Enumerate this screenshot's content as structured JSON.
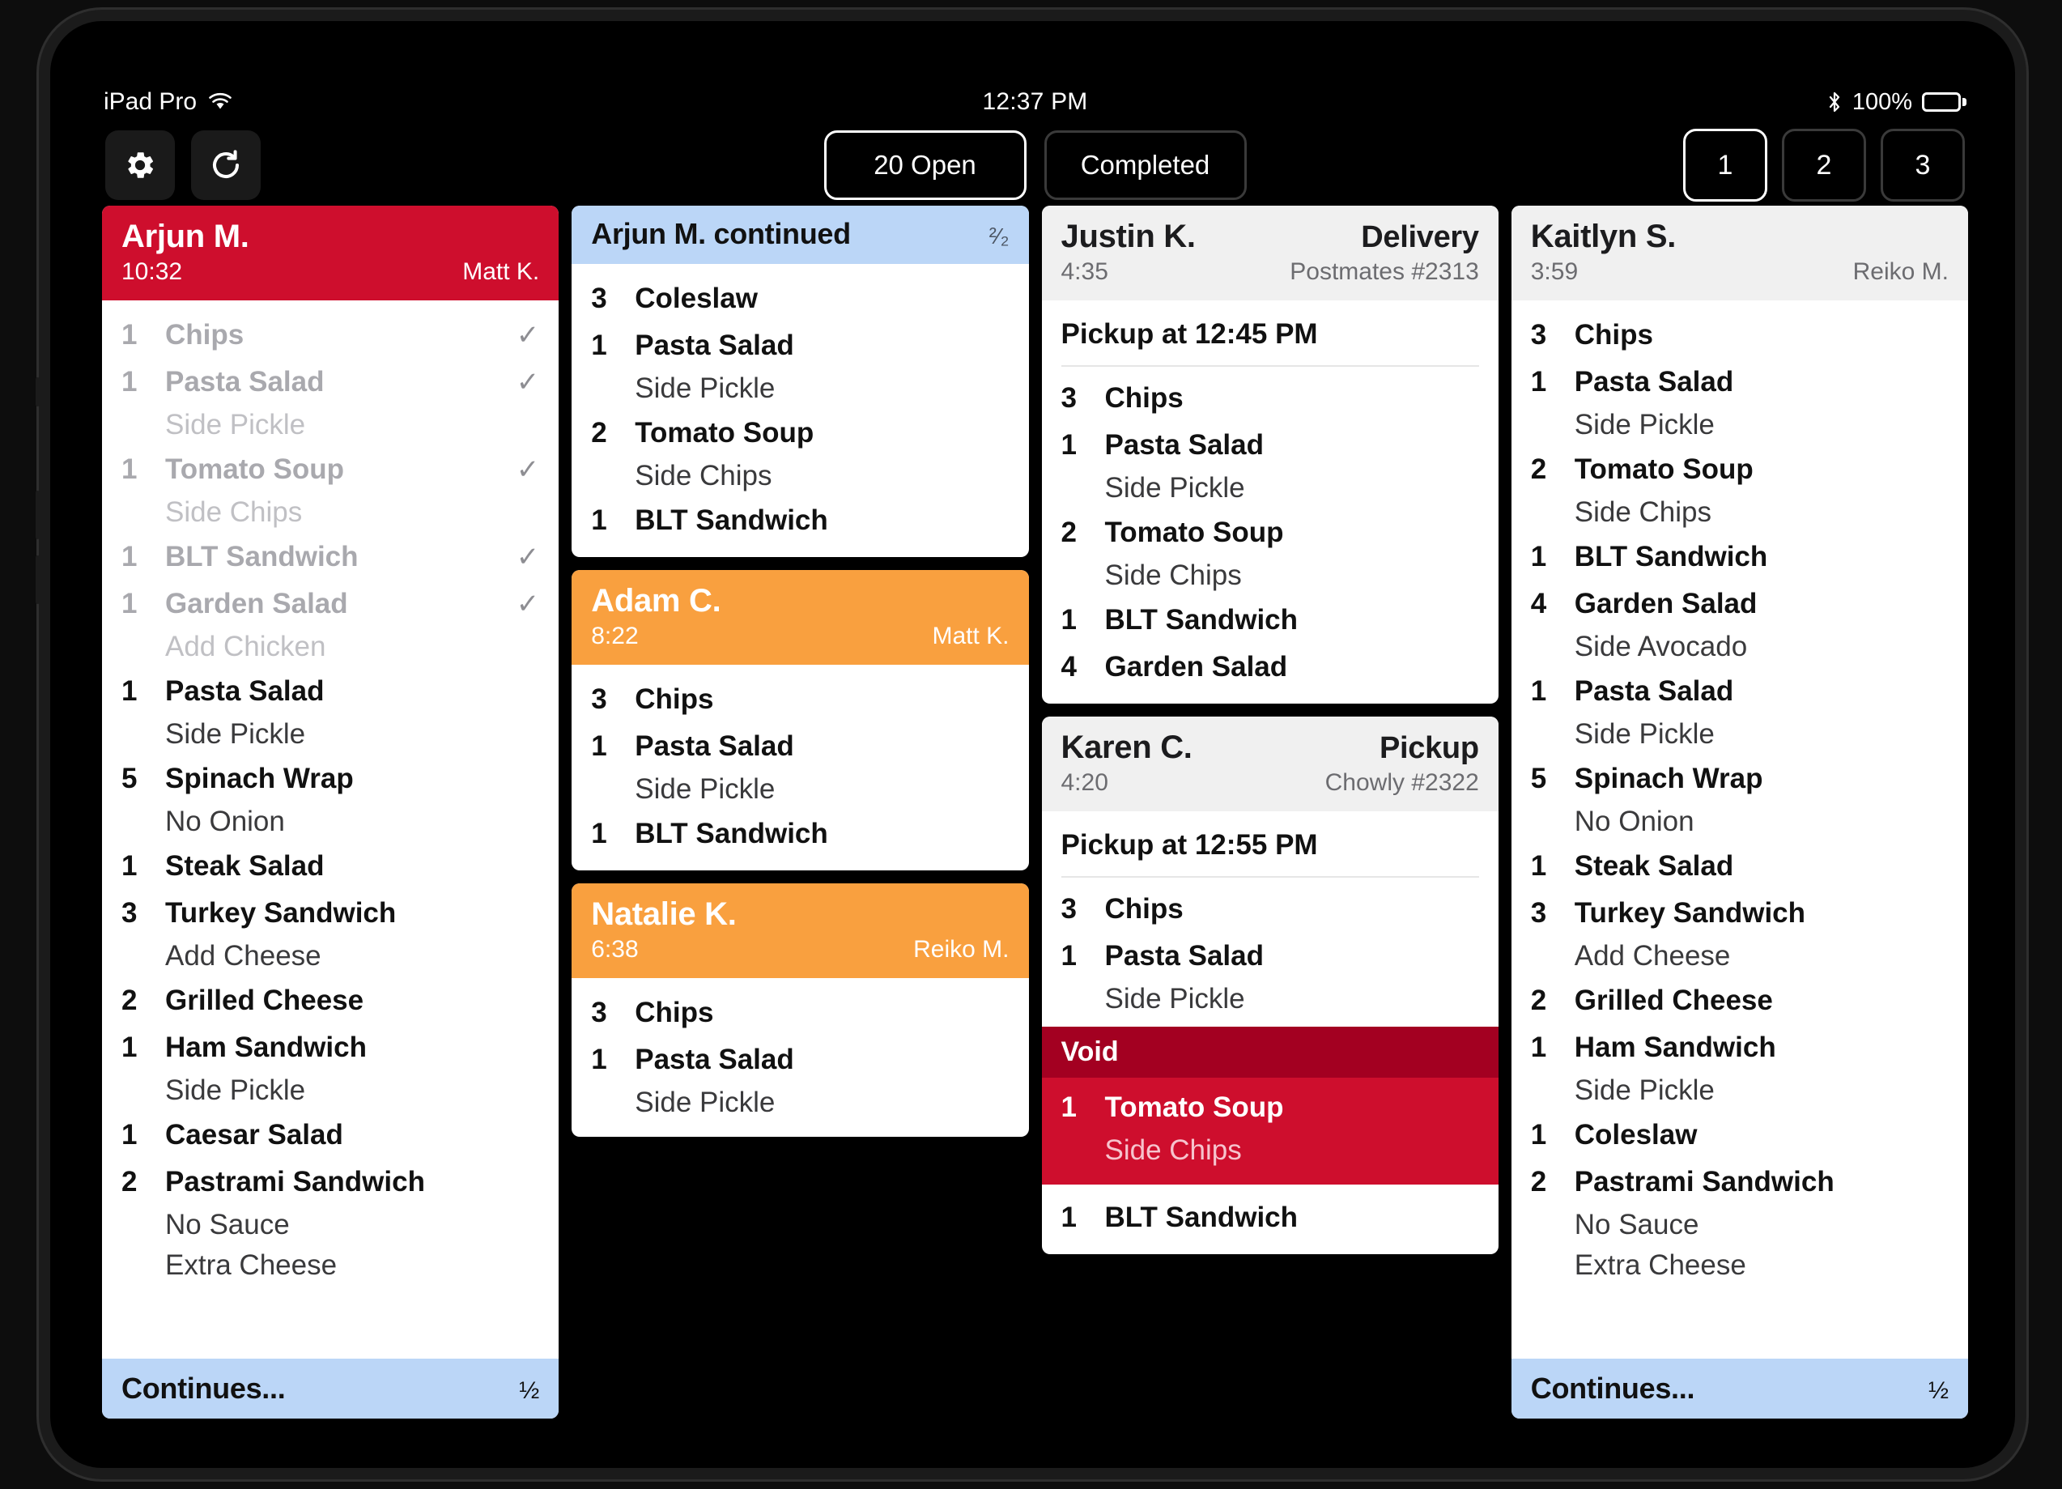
{
  "status_bar": {
    "device": "iPad Pro",
    "wifi_icon": "wifi-icon",
    "time": "12:37 PM",
    "bluetooth_icon": "bluetooth-icon",
    "battery_percent": "100%",
    "battery_icon": "battery-full-icon"
  },
  "toolbar": {
    "settings_icon": "gear-icon",
    "refresh_icon": "refresh-icon",
    "tabs": [
      {
        "label": "20 Open",
        "active": true
      },
      {
        "label": "Completed",
        "active": false
      }
    ],
    "pages": [
      {
        "label": "1",
        "active": true
      },
      {
        "label": "2",
        "active": false
      },
      {
        "label": "3",
        "active": false
      }
    ]
  },
  "colors": {
    "red": "#CE0E2D",
    "red_dark": "#A30021",
    "orange": "#F9A03F",
    "gray_header": "#F0F0F0",
    "blue_footer": "#BBD6F7"
  },
  "columns": [
    {
      "tickets": [
        {
          "name": "Arjun M.",
          "time": "10:32",
          "server": "Matt K.",
          "header_style": "red",
          "items": [
            {
              "qty": "1",
              "name": "Chips",
              "done": true,
              "check": "✓"
            },
            {
              "qty": "1",
              "name": "Pasta Salad",
              "done": true,
              "check": "✓"
            },
            {
              "mod": "Side Pickle",
              "done": true
            },
            {
              "qty": "1",
              "name": "Tomato Soup",
              "done": true,
              "check": "✓"
            },
            {
              "mod": "Side Chips",
              "done": true
            },
            {
              "qty": "1",
              "name": "BLT Sandwich",
              "done": true,
              "check": "✓"
            },
            {
              "qty": "1",
              "name": "Garden Salad",
              "done": true,
              "check": "✓"
            },
            {
              "mod": "Add Chicken",
              "done": true
            },
            {
              "qty": "1",
              "name": "Pasta Salad"
            },
            {
              "mod": "Side Pickle"
            },
            {
              "qty": "5",
              "name": "Spinach Wrap"
            },
            {
              "mod": "No Onion"
            },
            {
              "qty": "1",
              "name": "Steak Salad"
            },
            {
              "qty": "3",
              "name": "Turkey Sandwich"
            },
            {
              "mod": "Add Cheese"
            },
            {
              "qty": "2",
              "name": "Grilled Cheese"
            },
            {
              "qty": "1",
              "name": "Ham Sandwich"
            },
            {
              "mod": "Side Pickle"
            },
            {
              "qty": "1",
              "name": "Caesar Salad"
            },
            {
              "qty": "2",
              "name": "Pastrami Sandwich"
            },
            {
              "mod": "No Sauce"
            },
            {
              "mod": "Extra Cheese"
            }
          ],
          "footer": {
            "label": "Continues...",
            "fraction": "½"
          }
        }
      ]
    },
    {
      "tickets": [
        {
          "continuation_title": "Arjun M. continued",
          "fraction": "²⁄₂",
          "items": [
            {
              "qty": "3",
              "name": "Coleslaw"
            },
            {
              "qty": "1",
              "name": "Pasta Salad"
            },
            {
              "mod": "Side Pickle"
            },
            {
              "qty": "2",
              "name": "Tomato Soup"
            },
            {
              "mod": "Side Chips"
            },
            {
              "qty": "1",
              "name": "BLT Sandwich"
            }
          ]
        },
        {
          "name": "Adam C.",
          "time": "8:22",
          "server": "Matt K.",
          "header_style": "orange",
          "items": [
            {
              "qty": "3",
              "name": "Chips"
            },
            {
              "qty": "1",
              "name": "Pasta Salad"
            },
            {
              "mod": "Side Pickle"
            },
            {
              "qty": "1",
              "name": "BLT Sandwich"
            }
          ]
        },
        {
          "name": "Natalie K.",
          "time": "6:38",
          "server": "Reiko M.",
          "header_style": "orange",
          "items": [
            {
              "qty": "3",
              "name": "Chips"
            },
            {
              "qty": "1",
              "name": "Pasta Salad"
            },
            {
              "mod": "Side Pickle"
            }
          ]
        }
      ]
    },
    {
      "tickets": [
        {
          "name": "Justin K.",
          "time": "4:35",
          "order_type": "Delivery",
          "source": "Postmates #2313",
          "header_style": "gray",
          "pickup_line": "Pickup at 12:45 PM",
          "items": [
            {
              "qty": "3",
              "name": "Chips"
            },
            {
              "qty": "1",
              "name": "Pasta Salad"
            },
            {
              "mod": "Side Pickle"
            },
            {
              "qty": "2",
              "name": "Tomato Soup"
            },
            {
              "mod": "Side Chips"
            },
            {
              "qty": "1",
              "name": "BLT Sandwich"
            },
            {
              "qty": "4",
              "name": "Garden Salad"
            }
          ]
        },
        {
          "name": "Karen C.",
          "time": "4:20",
          "order_type": "Pickup",
          "source": "Chowly #2322",
          "header_style": "gray",
          "pickup_line": "Pickup at 12:55 PM",
          "items": [
            {
              "qty": "3",
              "name": "Chips"
            },
            {
              "qty": "1",
              "name": "Pasta Salad"
            },
            {
              "mod": "Side Pickle"
            }
          ],
          "void": {
            "label": "Void",
            "items": [
              {
                "qty": "1",
                "name": "Tomato Soup"
              },
              {
                "mod": "Side Chips"
              }
            ]
          },
          "items_after_void": [
            {
              "qty": "1",
              "name": "BLT Sandwich"
            }
          ]
        }
      ]
    },
    {
      "tickets": [
        {
          "name": "Kaitlyn S.",
          "time": "3:59",
          "server": "Reiko M.",
          "header_style": "gray",
          "items": [
            {
              "qty": "3",
              "name": "Chips"
            },
            {
              "qty": "1",
              "name": "Pasta Salad"
            },
            {
              "mod": "Side Pickle"
            },
            {
              "qty": "2",
              "name": "Tomato Soup"
            },
            {
              "mod": "Side Chips"
            },
            {
              "qty": "1",
              "name": "BLT Sandwich"
            },
            {
              "qty": "4",
              "name": "Garden Salad"
            },
            {
              "mod": "Side Avocado"
            },
            {
              "qty": "1",
              "name": "Pasta Salad"
            },
            {
              "mod": "Side Pickle"
            },
            {
              "qty": "5",
              "name": "Spinach Wrap"
            },
            {
              "mod": "No Onion"
            },
            {
              "qty": "1",
              "name": "Steak Salad"
            },
            {
              "qty": "3",
              "name": "Turkey Sandwich"
            },
            {
              "mod": "Add Cheese"
            },
            {
              "qty": "2",
              "name": "Grilled Cheese"
            },
            {
              "qty": "1",
              "name": "Ham Sandwich"
            },
            {
              "mod": "Side Pickle"
            },
            {
              "qty": "1",
              "name": "Coleslaw"
            },
            {
              "qty": "2",
              "name": "Pastrami Sandwich"
            },
            {
              "mod": "No Sauce"
            },
            {
              "mod": "Extra Cheese"
            }
          ],
          "footer": {
            "label": "Continues...",
            "fraction": "½"
          }
        }
      ]
    }
  ]
}
